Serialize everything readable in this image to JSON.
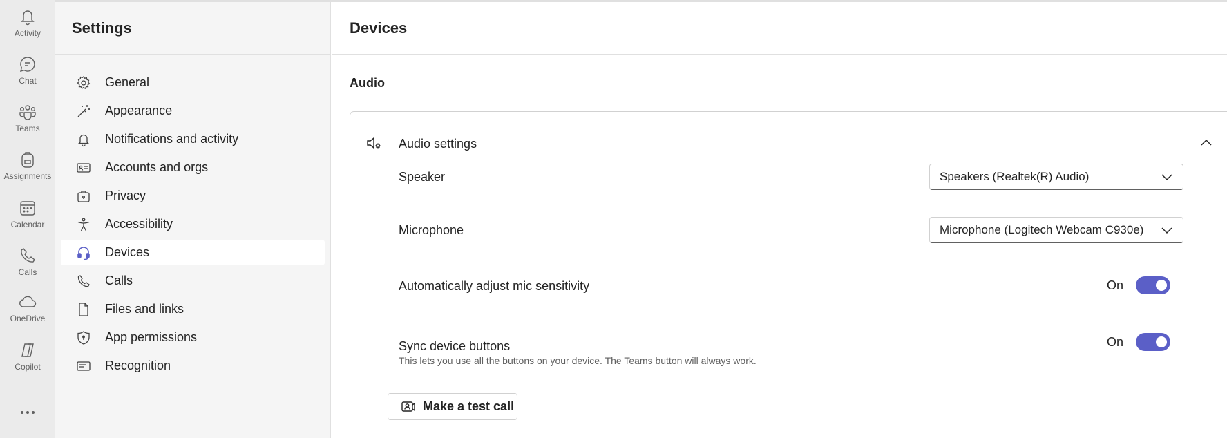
{
  "rail": {
    "items": [
      {
        "label": "Activity",
        "icon": "bell-icon"
      },
      {
        "label": "Chat",
        "icon": "chat-icon"
      },
      {
        "label": "Teams",
        "icon": "teams-icon"
      },
      {
        "label": "Assignments",
        "icon": "backpack-icon"
      },
      {
        "label": "Calendar",
        "icon": "calendar-icon"
      },
      {
        "label": "Calls",
        "icon": "phone-icon"
      },
      {
        "label": "OneDrive",
        "icon": "cloud-icon"
      },
      {
        "label": "Copilot",
        "icon": "copilot-icon"
      }
    ],
    "more_icon": "more-horizontal-icon"
  },
  "settings_nav": {
    "title": "Settings",
    "items": [
      {
        "label": "General",
        "icon": "gear-icon"
      },
      {
        "label": "Appearance",
        "icon": "magic-wand-icon"
      },
      {
        "label": "Notifications and activity",
        "icon": "bell-icon"
      },
      {
        "label": "Accounts and orgs",
        "icon": "contact-card-icon"
      },
      {
        "label": "Privacy",
        "icon": "lock-briefcase-icon"
      },
      {
        "label": "Accessibility",
        "icon": "accessibility-icon"
      },
      {
        "label": "Devices",
        "icon": "headset-icon",
        "active": true
      },
      {
        "label": "Calls",
        "icon": "phone-icon"
      },
      {
        "label": "Files and links",
        "icon": "document-icon"
      },
      {
        "label": "App permissions",
        "icon": "shield-icon"
      },
      {
        "label": "Recognition",
        "icon": "text-box-icon"
      }
    ]
  },
  "main": {
    "title": "Devices",
    "section_title": "Audio",
    "audio_card": {
      "title": "Audio settings",
      "icon": "speaker-settings-icon",
      "expanded": true,
      "speaker": {
        "label": "Speaker",
        "value": "Speakers (Realtek(R) Audio)"
      },
      "microphone": {
        "label": "Microphone",
        "value": "Microphone (Logitech Webcam C930e)"
      },
      "auto_adjust": {
        "label": "Automatically adjust mic sensitivity",
        "state": "On",
        "enabled": true
      },
      "sync_buttons": {
        "label": "Sync device buttons",
        "description": "This lets you use all the buttons on your device. The Teams button will always work.",
        "state": "On",
        "enabled": true
      },
      "test_call_label": "Make a test call"
    }
  },
  "colors": {
    "accent": "#5b5fc7",
    "rail_bg": "#ebebeb",
    "nav_bg": "#f5f5f5",
    "text": "#242424"
  }
}
